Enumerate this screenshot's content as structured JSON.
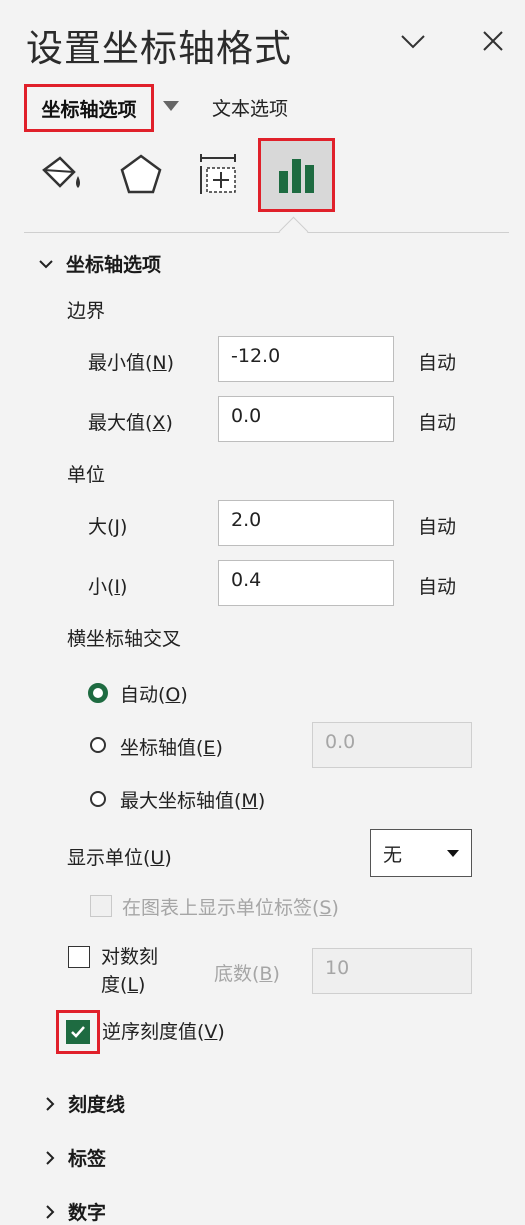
{
  "header": {
    "title": "设置坐标轴格式"
  },
  "tabs": {
    "axis_options": "坐标轴选项",
    "text_options": "文本选项"
  },
  "icons": {
    "fill": "fill-line-icon",
    "effects": "effects-pentagon-icon",
    "size": "size-properties-icon",
    "axis": "bar-chart-icon",
    "collapse": "chevron-down-icon",
    "close": "close-icon"
  },
  "colors": {
    "accent_green": "#1e6b41",
    "highlight_red": "#e0202a"
  },
  "axis_options": {
    "heading": "坐标轴选项",
    "bounds": {
      "label": "边界",
      "min": {
        "label": "最小值(N)",
        "value": "-12.0",
        "auto": "自动"
      },
      "max": {
        "label": "最大值(X)",
        "value": "0.0",
        "auto": "自动"
      }
    },
    "units": {
      "label": "单位",
      "major": {
        "label": "大(J)",
        "value": "2.0",
        "auto": "自动"
      },
      "minor": {
        "label": "小(I)",
        "value": "0.4",
        "auto": "自动"
      }
    },
    "cross": {
      "label": "横坐标轴交叉",
      "auto": "自动(O)",
      "axis_value": "坐标轴值(E)",
      "axis_value_input": "0.0",
      "max_axis_value": "最大坐标轴值(M)",
      "selected": "auto"
    },
    "display_units": {
      "label": "显示单位(U)",
      "value": "无"
    },
    "show_units_label": "在图表上显示单位标签(S)",
    "log_scale": {
      "label_line1": "对数刻",
      "label_line2": "度(L)",
      "base_label": "底数(B)",
      "base_value": "10",
      "checked": false
    },
    "reverse_order": {
      "label": "逆序刻度值(V)",
      "checked": true
    }
  },
  "sections": {
    "tick_marks": "刻度线",
    "labels": "标签",
    "number": "数字"
  }
}
